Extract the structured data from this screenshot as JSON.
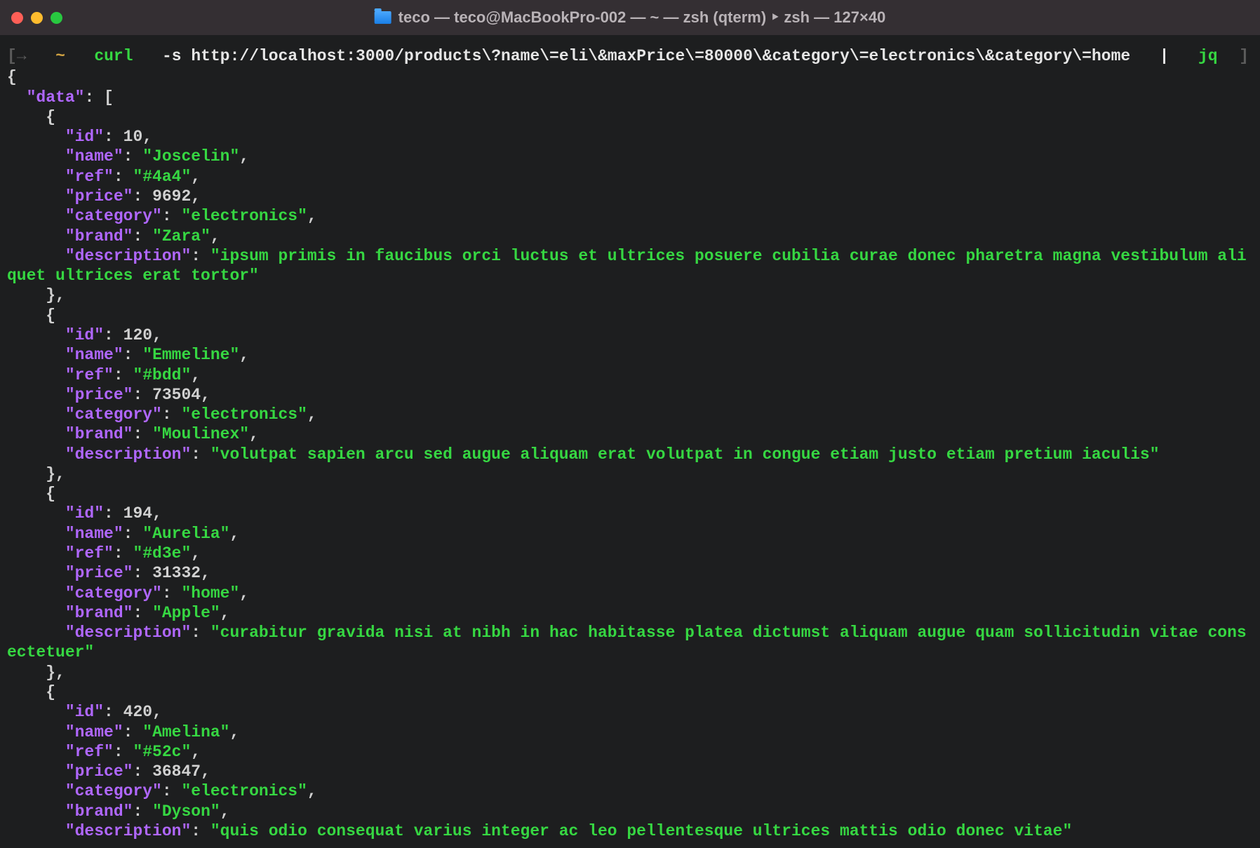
{
  "window": {
    "title_parts": [
      "teco — teco@MacBookPro-002 — ~ — zsh (qterm) ‣ zsh — 127×40"
    ]
  },
  "prompt": {
    "arrow": "→",
    "tilde": "~",
    "cmd": "curl",
    "args": "-s http://localhost:3000/products\\?name\\=eli\\&maxPrice\\=80000\\&category\\=electronics\\&category\\=home",
    "pipe": "|",
    "jq": "jq",
    "leftb": "[",
    "rightb": "]"
  },
  "json_output": {
    "root_open": "{",
    "data_key": "\"data\"",
    "array_open": ": [",
    "items": [
      {
        "id": 10,
        "name": "Joscelin",
        "ref": "#4a4",
        "price": 9692,
        "category": "electronics",
        "brand": "Zara",
        "description": "ipsum primis in faucibus orci luctus et ultrices posuere cubilia curae donec pharetra magna vestibulum aliquet ultrices erat tortor"
      },
      {
        "id": 120,
        "name": "Emmeline",
        "ref": "#bdd",
        "price": 73504,
        "category": "electronics",
        "brand": "Moulinex",
        "description": "volutpat sapien arcu sed augue aliquam erat volutpat in congue etiam justo etiam pretium iaculis"
      },
      {
        "id": 194,
        "name": "Aurelia",
        "ref": "#d3e",
        "price": 31332,
        "category": "home",
        "brand": "Apple",
        "description": "curabitur gravida nisi at nibh in hac habitasse platea dictumst aliquam augue quam sollicitudin vitae consectetuer"
      },
      {
        "id": 420,
        "name": "Amelina",
        "ref": "#52c",
        "price": 36847,
        "category": "electronics",
        "brand": "Dyson",
        "description": "quis odio consequat varius integer ac leo pellentesque ultrices mattis odio donec vitae"
      }
    ],
    "keys": {
      "id": "\"id\"",
      "name": "\"name\"",
      "ref": "\"ref\"",
      "price": "\"price\"",
      "category": "\"category\"",
      "brand": "\"brand\"",
      "description": "\"description\""
    }
  }
}
